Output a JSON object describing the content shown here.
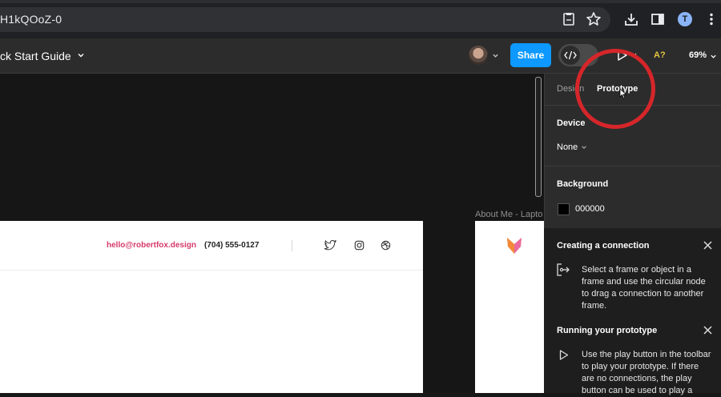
{
  "browser": {
    "url": "H1kQOoZ-0",
    "icons": [
      "bookmark-save-icon",
      "star-icon",
      "download-icon",
      "sidebar-icon",
      "profile-icon",
      "more-icon"
    ],
    "profile_initial": "T"
  },
  "toolbar": {
    "file_title": "ck Start Guide",
    "share_label": "Share",
    "a11y_label": "A?",
    "zoom_label": "69%"
  },
  "canvas": {
    "frame1": {
      "email": "hello@robertfox.design",
      "phone": "(704) 555-0127"
    },
    "frame2_label": "About Me - Lapto"
  },
  "panel": {
    "tabs": [
      "Design",
      "Prototype"
    ],
    "device_heading": "Device",
    "device_value": "None",
    "background_heading": "Background",
    "background_value": "000000",
    "connection": {
      "title": "Creating a connection",
      "text": "Select a frame or object in a frame and use the circular node to drag a connection to another frame."
    },
    "running": {
      "title": "Running your prototype",
      "text": "Use the play button in the toolbar to play your prototype. If there are no connections, the play button can be used to play a"
    }
  },
  "colors": {
    "accent": "#0d99ff",
    "highlight_circle": "#d6262a",
    "email_pink": "#d63a6a"
  }
}
